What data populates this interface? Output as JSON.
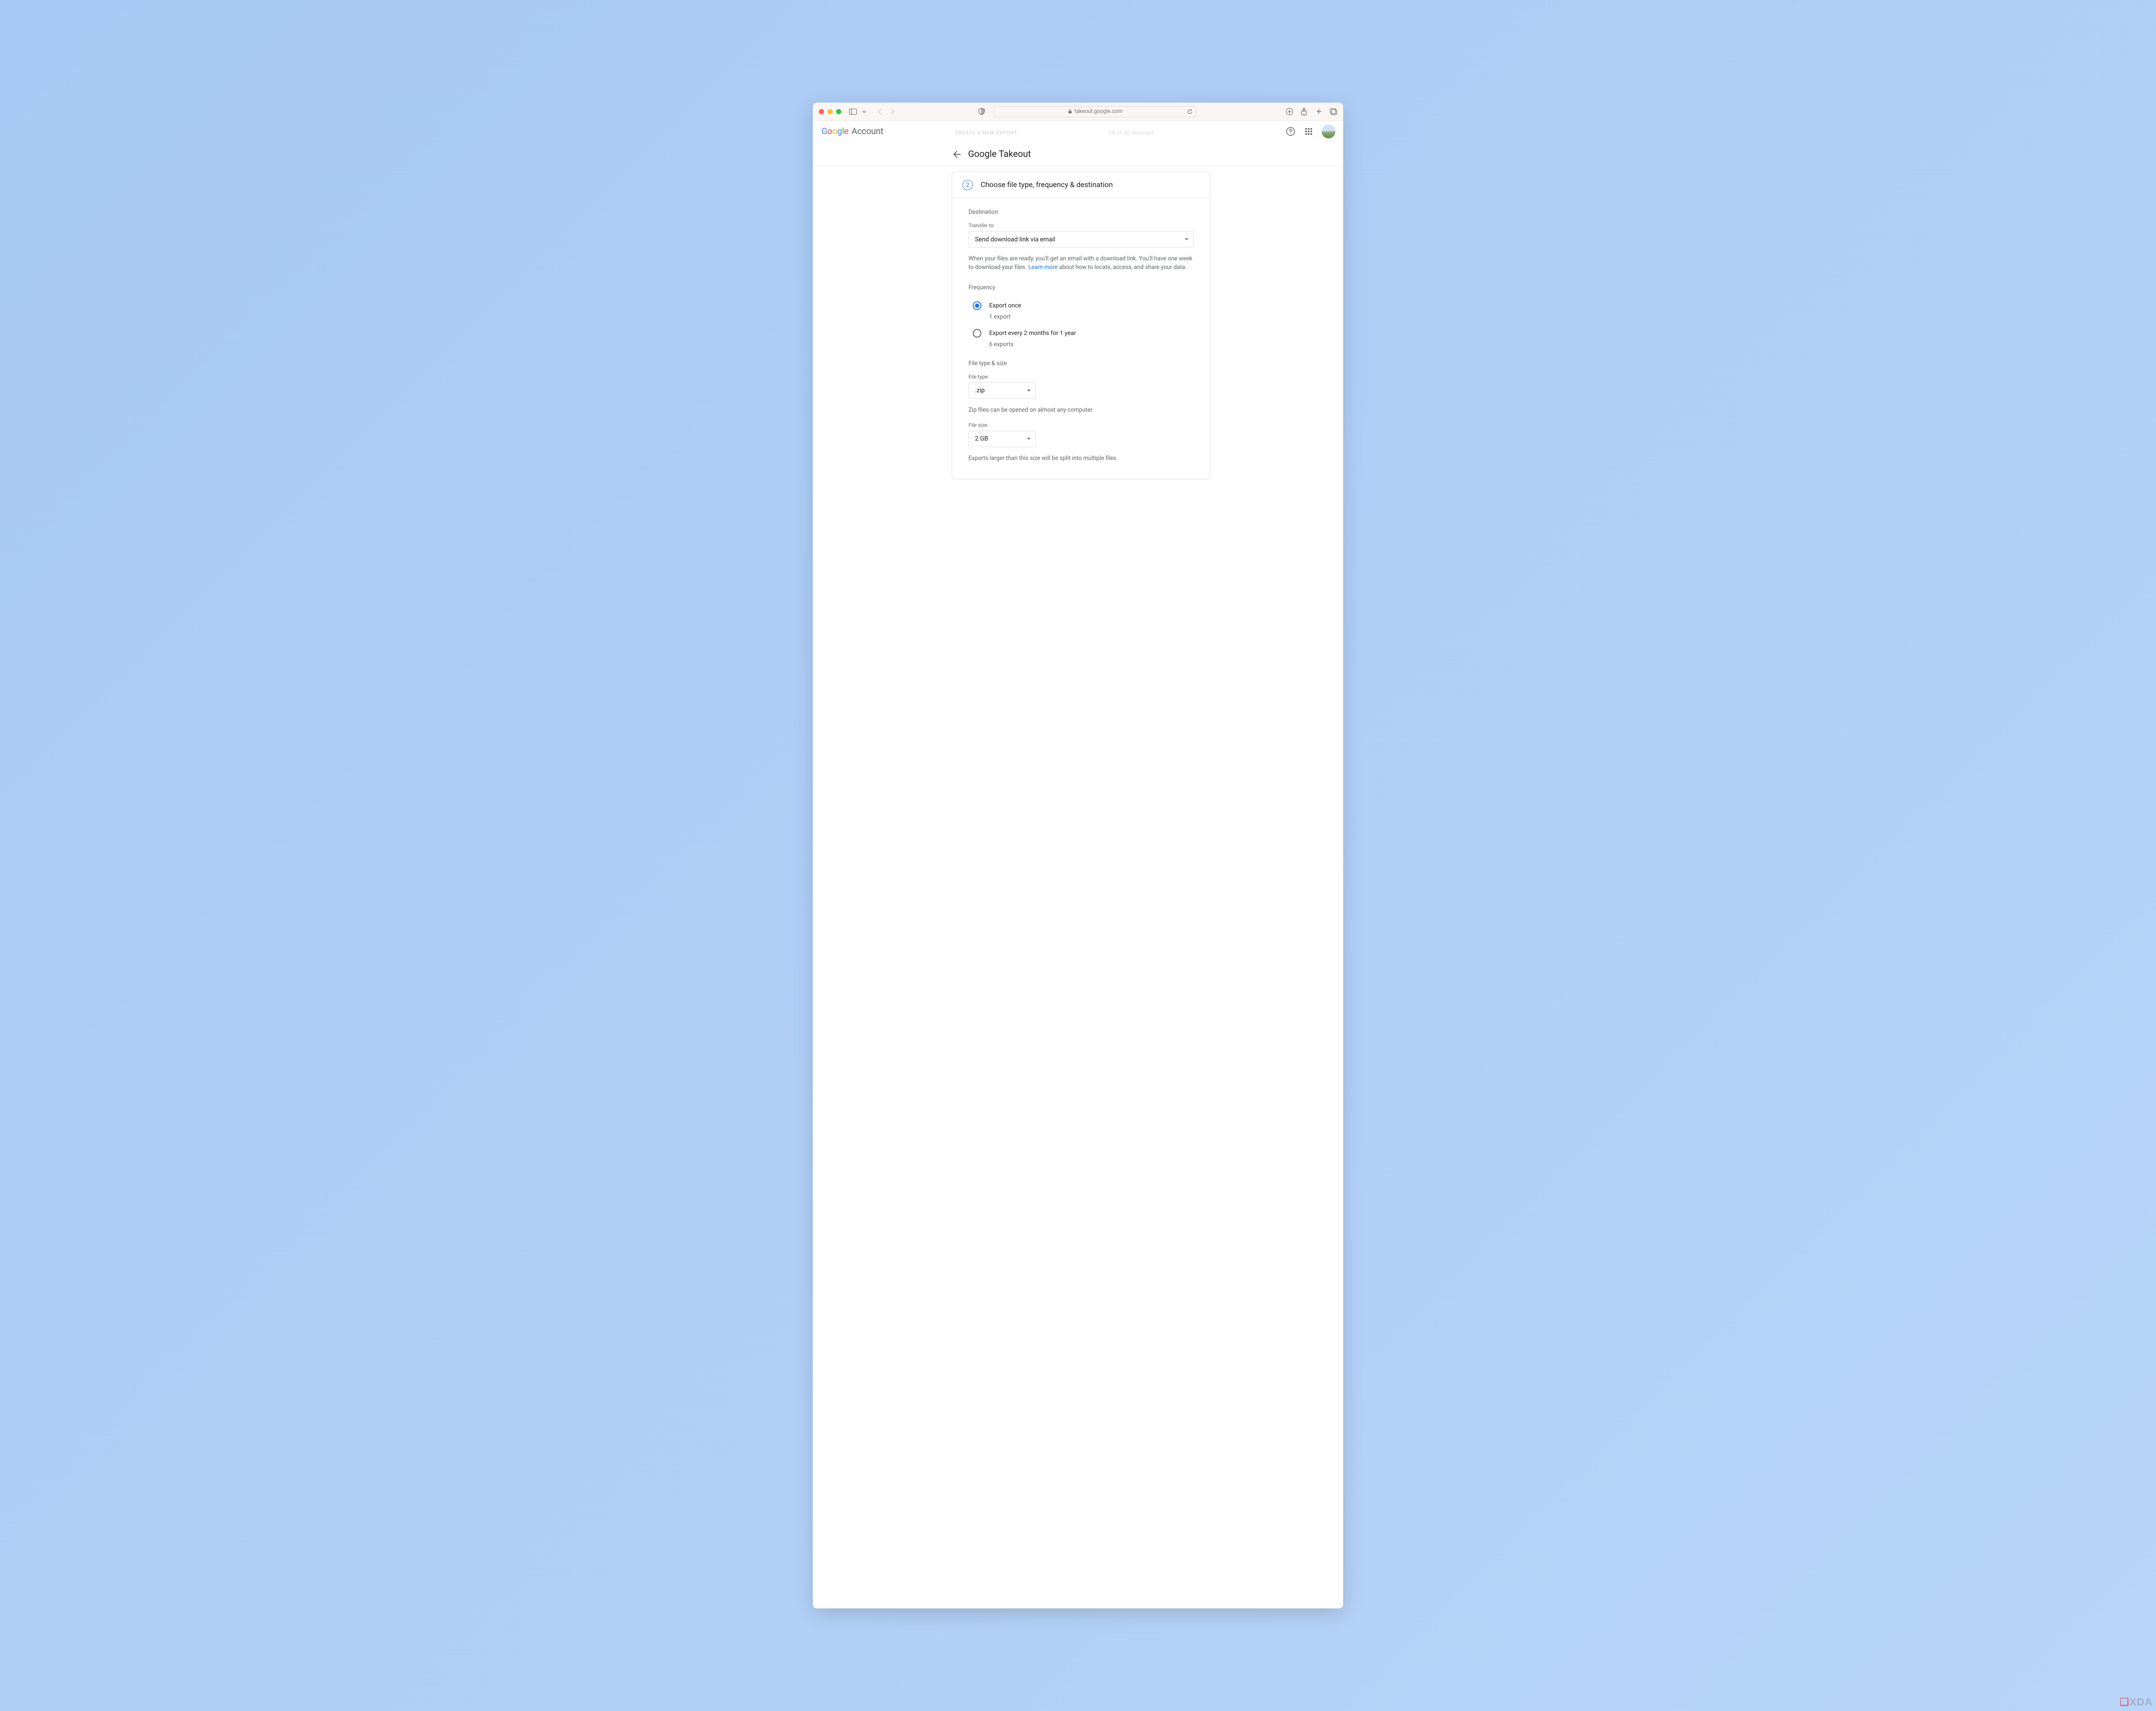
{
  "browser": {
    "url": "takeout.google.com",
    "ghost_left": "CREATE A NEW EXPORT",
    "ghost_right": "50 of 50 selected"
  },
  "google_header": {
    "account_label": "Account"
  },
  "page": {
    "title": "Google Takeout"
  },
  "card": {
    "step": "2",
    "title": "Choose file type, frequency & destination"
  },
  "destination": {
    "heading": "Destination",
    "transfer_label": "Transfer to:",
    "transfer_value": "Send download link via email",
    "help_before": "When your files are ready, you'll get an email with a download link. You'll have one week to download your files. ",
    "learn_more": "Learn more",
    "help_after": " about how to locate, access, and share your data."
  },
  "frequency": {
    "heading": "Frequency",
    "opt1_label": "Export once",
    "opt1_sub": "1 export",
    "opt2_label": "Export every 2 months for 1 year",
    "opt2_sub": "6 exports"
  },
  "filetype": {
    "heading": "File type & size",
    "type_label": "File type:",
    "type_value": ".zip",
    "type_help": "Zip files can be opened on almost any computer.",
    "size_label": "File size:",
    "size_value": "2 GB",
    "size_help": "Exports larger than this size will be split into multiple files."
  },
  "watermark": "XDA"
}
